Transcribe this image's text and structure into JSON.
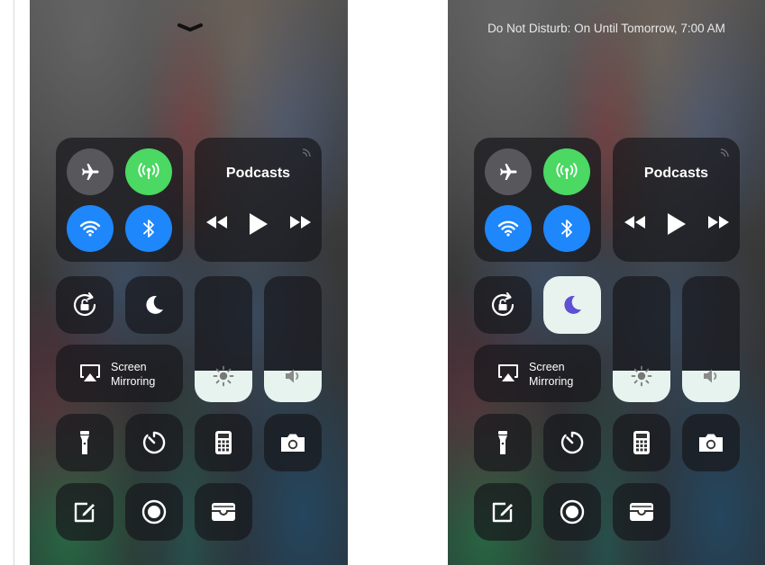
{
  "left_screen": {
    "media": {
      "title": "Podcasts"
    },
    "screen_mirroring": {
      "line1": "Screen",
      "line2": "Mirroring"
    },
    "brightness": {
      "level": 0.25
    },
    "volume": {
      "level": 0.25
    },
    "do_not_disturb": {
      "on": false
    }
  },
  "right_screen": {
    "status": {
      "text": "Do Not Disturb: On Until Tomorrow, 7:00 AM"
    },
    "media": {
      "title": "Podcasts"
    },
    "screen_mirroring": {
      "line1": "Screen",
      "line2": "Mirroring"
    },
    "brightness": {
      "level": 0.25
    },
    "volume": {
      "level": 0.25
    },
    "do_not_disturb": {
      "on": true
    }
  },
  "icons": [
    "chevron-down-icon",
    "airplane-icon",
    "cellular-icon",
    "wifi-icon",
    "bluetooth-icon",
    "airplay-icon",
    "rewind-icon",
    "play-icon",
    "forward-icon",
    "rotation-lock-icon",
    "moon-icon",
    "sun-icon",
    "speaker-icon",
    "screen-mirroring-icon",
    "flashlight-icon",
    "timer-icon",
    "calculator-icon",
    "camera-icon",
    "notes-icon",
    "record-icon",
    "wallet-icon"
  ],
  "colors": {
    "cellular_on": "#4bd863",
    "wifi_on": "#1d87fb",
    "bluetooth_on": "#1d87fb",
    "dnd_on_tile": "#e8f3f0",
    "dnd_moon_on": "#5e4fd4",
    "slider_fill": "#e6f3ef"
  }
}
